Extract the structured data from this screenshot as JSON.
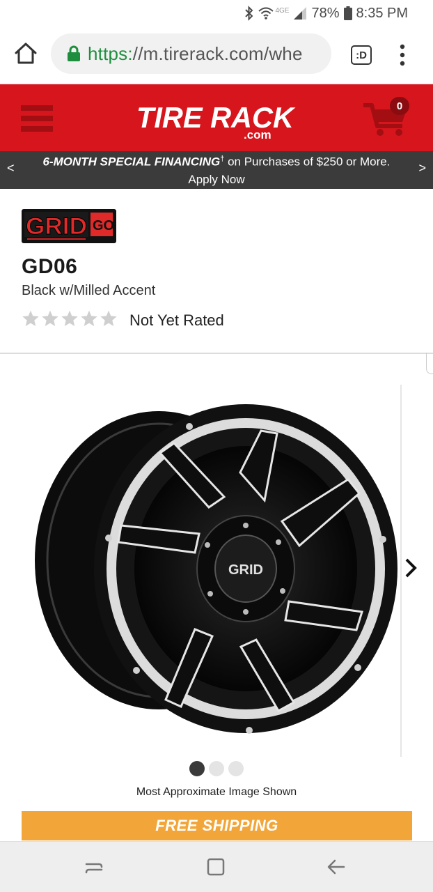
{
  "status": {
    "network_label": "4GE",
    "battery": "78%",
    "time": "8:35 PM"
  },
  "browser": {
    "url_scheme": "https:",
    "url_rest": "//m.tirerack.com/whe",
    "tab_label": ":D"
  },
  "header": {
    "logo_text": "TIRE RACK",
    "logo_sub": ".com",
    "cart_count": "0",
    "brand_color": "#d7151c"
  },
  "promo": {
    "prev": "<",
    "strong": "6-MONTH SPECIAL FINANCING",
    "dagger": "†",
    "text": " on Purchases of $250 or More.",
    "cta": "Apply Now",
    "next": ">"
  },
  "product": {
    "brand_logo_text": "GRID",
    "brand_logo_badge": "GO",
    "name": "GD06",
    "finish": "Black w/Milled Accent",
    "rating_text": "Not Yet Rated",
    "stars_filled": 0,
    "stars_total": 5
  },
  "gallery": {
    "image_count": 3,
    "active_index": 0,
    "caption": "Most Approximate Image Shown",
    "hub_label": "GRID"
  },
  "shipping": {
    "label": "FREE SHIPPING",
    "color": "#f2a63a"
  }
}
